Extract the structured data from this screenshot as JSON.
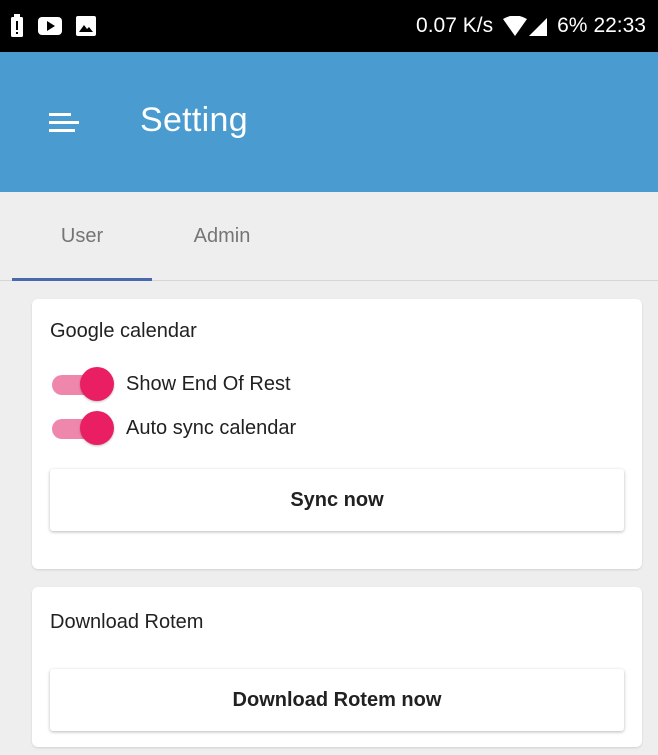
{
  "status_bar": {
    "net_speed": "0.07 K/s",
    "battery": "6%",
    "time": "22:33",
    "icons": [
      "battery-alert-icon",
      "youtube-icon",
      "gallery-icon",
      "wifi-icon",
      "signal-icon"
    ]
  },
  "app_bar": {
    "title": "Setting",
    "menu_icon": "hamburger-menu-icon",
    "color": "#4a9bd0"
  },
  "tabs": [
    {
      "label": "User",
      "selected": true
    },
    {
      "label": "Admin",
      "selected": false
    }
  ],
  "google_calendar": {
    "title": "Google calendar",
    "toggles": [
      {
        "label": "Show End Of Rest",
        "on": true
      },
      {
        "label": "Auto sync calendar",
        "on": true
      }
    ],
    "button_label": "Sync now"
  },
  "download": {
    "title": "Download Rotem",
    "button_label": "Download Rotem now"
  },
  "colors": {
    "accent": "#e91e63",
    "tab_indicator": "#4a67b0"
  }
}
